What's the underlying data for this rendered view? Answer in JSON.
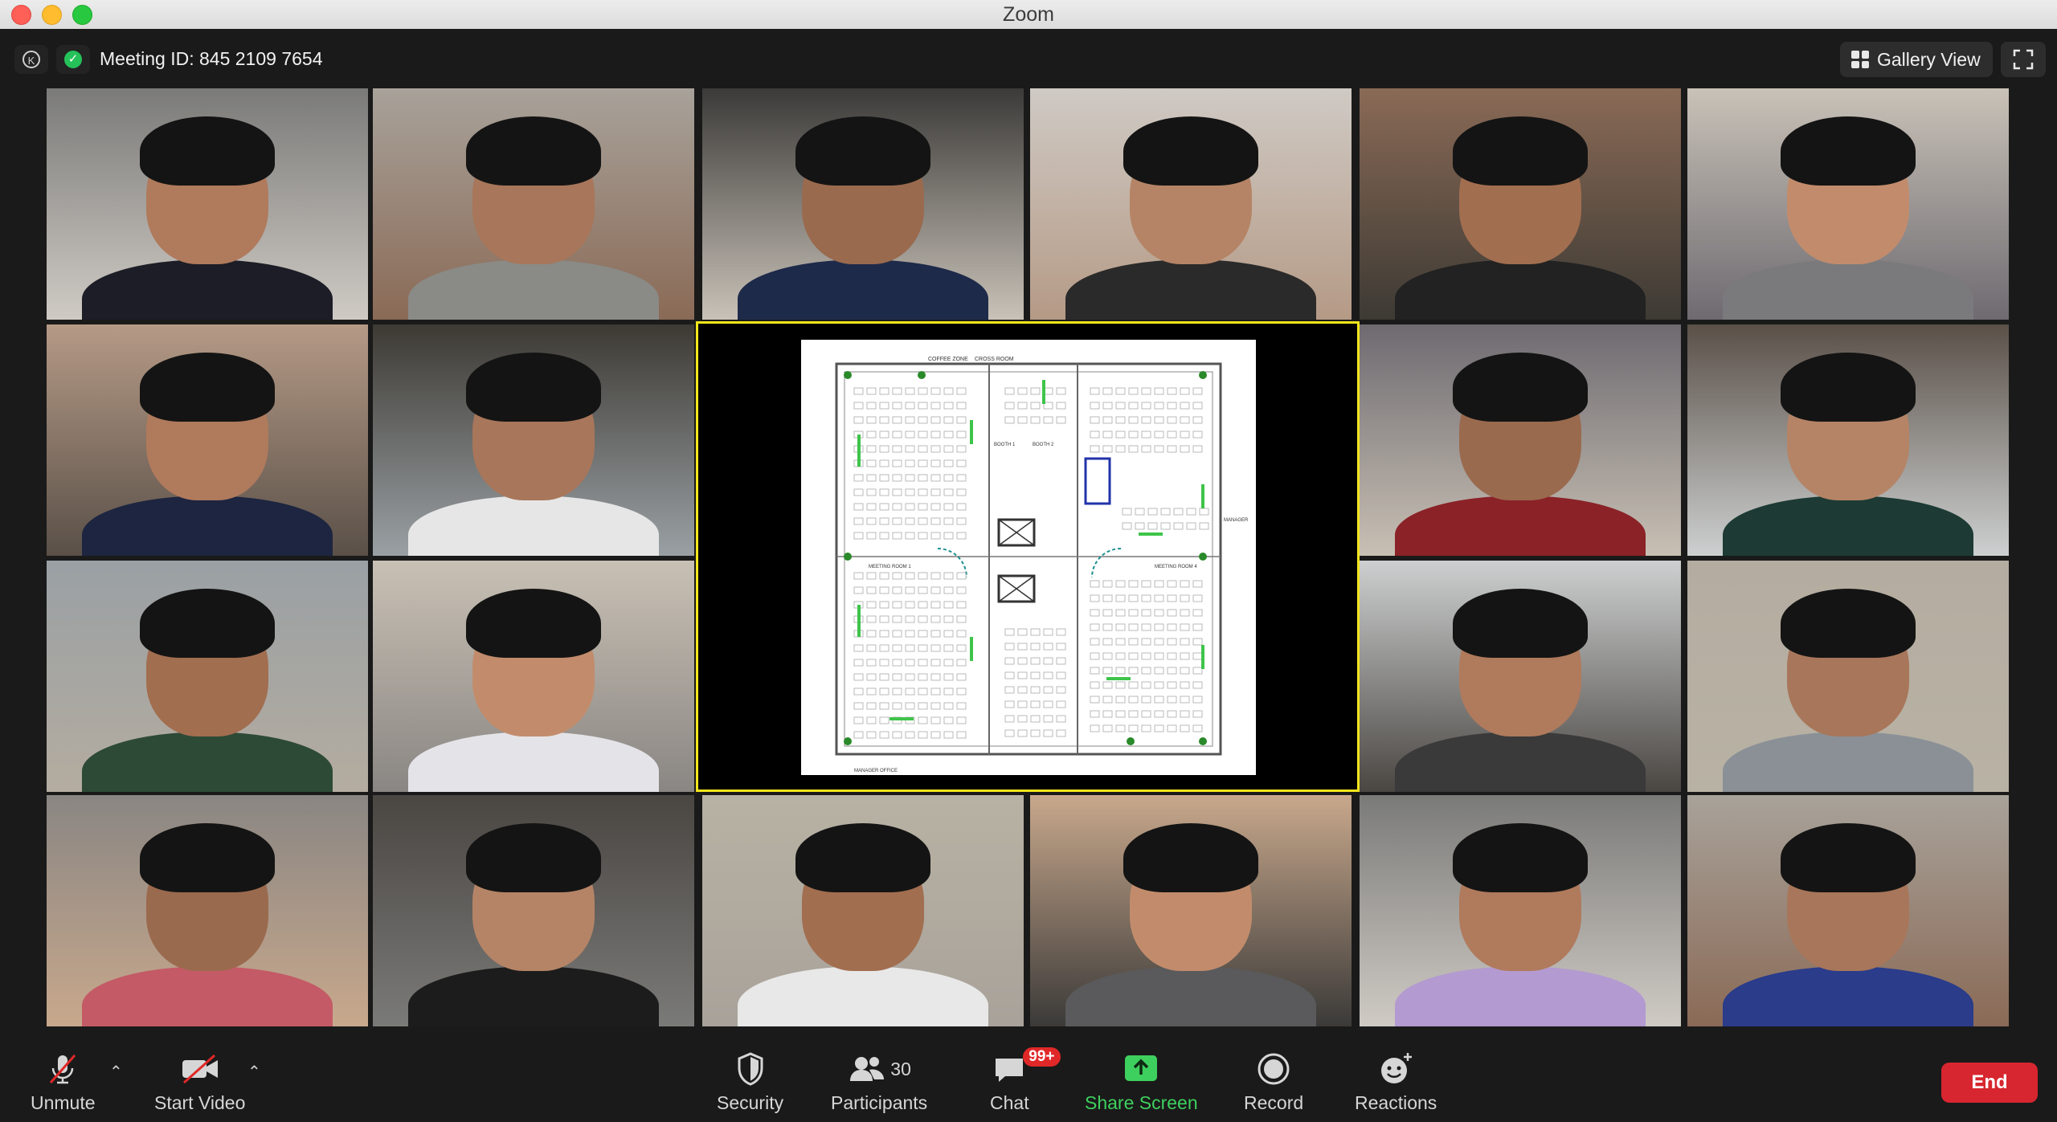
{
  "window": {
    "title": "Zoom"
  },
  "header": {
    "meeting_id_label": "Meeting ID: 845 2109 7654",
    "view_label": "Gallery View"
  },
  "colors": {
    "share_border": "#f2e51b",
    "end_button": "#d7262f",
    "share_screen_green": "#3ed05e",
    "badge_red": "#e02828"
  },
  "share": {
    "plan_labels": [
      "COFFEE ZONE",
      "CROSS ROOM",
      "BOOTH 1",
      "BOOTH 2",
      "MEETING ROOM 1",
      "MEETING ROOM 4",
      "MANAGER",
      "MANAGER OFFICE"
    ]
  },
  "toolbar": {
    "unmute_label": "Unmute",
    "start_video_label": "Start Video",
    "security_label": "Security",
    "participants_label": "Participants",
    "participants_count": "30",
    "chat_label": "Chat",
    "chat_badge": "99+",
    "share_screen_label": "Share Screen",
    "record_label": "Record",
    "reactions_label": "Reactions",
    "end_label": "End"
  }
}
